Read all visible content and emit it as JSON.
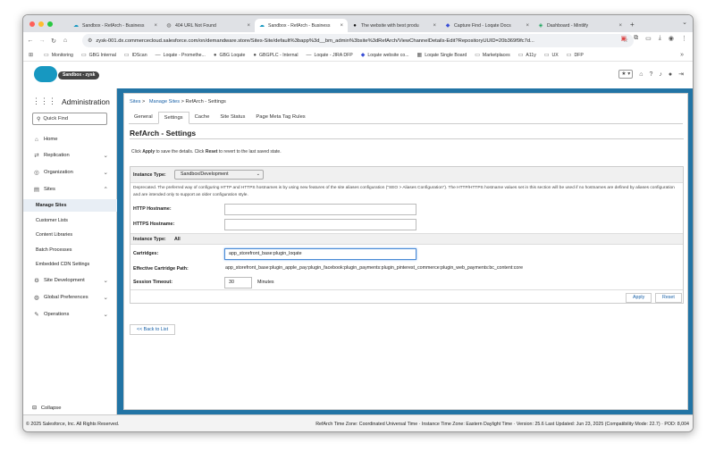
{
  "browser": {
    "tabs": [
      {
        "title": "Sandbox - RefArch - Business",
        "active": false,
        "icon": "salesforce-icon"
      },
      {
        "title": "404 URL Not Found",
        "active": false,
        "icon": "globe-icon"
      },
      {
        "title": "Sandbox - RefArch - Business",
        "active": true,
        "icon": "salesforce-icon"
      },
      {
        "title": "The website with best produ",
        "active": false,
        "icon": "dark-icon"
      },
      {
        "title": "Capture Find - Loqate Docs",
        "active": false,
        "icon": "loqate-icon"
      },
      {
        "title": "Dashboard - Mintlify",
        "active": false,
        "icon": "mintlify-icon"
      }
    ],
    "url": "zysk-001.dx.commercecloud.salesforce.com/on/demandware.store/Sites-Site/default%3bapp%3d__bm_admin%3bsite%3dRefArch/ViewChannelDetails-Edit?RepositoryUUID=20b369f9fc7d...",
    "bookmarks": [
      {
        "label": "Monitoring",
        "icon": "folder-icon"
      },
      {
        "label": "GBG Internal",
        "icon": "folder-icon"
      },
      {
        "label": "IDScan",
        "icon": "folder-icon"
      },
      {
        "label": "Loqate - Promethe...",
        "icon": "dash-icon"
      },
      {
        "label": "GBG Loqate",
        "icon": "github-icon"
      },
      {
        "label": "GBGPLC - Internal",
        "icon": "github-icon"
      },
      {
        "label": "Loqate - JIRA DFP",
        "icon": "dash-icon"
      },
      {
        "label": "Loqate website co...",
        "icon": "loqate-icon"
      },
      {
        "label": "Loqate Single Board",
        "icon": "board-icon"
      },
      {
        "label": "Marketplaces",
        "icon": "folder-icon"
      },
      {
        "label": "A11y",
        "icon": "folder-icon"
      },
      {
        "label": "UX",
        "icon": "folder-icon"
      },
      {
        "label": "DFP",
        "icon": "folder-icon"
      }
    ]
  },
  "header": {
    "org_label": "Sandbox - zysk"
  },
  "sidebar": {
    "title": "Administration",
    "quick_find_placeholder": "Quick Find",
    "items": [
      {
        "label": "Home",
        "icon": "home-icon",
        "chevron": ""
      },
      {
        "label": "Replication",
        "icon": "replication-icon",
        "chevron": "⌄"
      },
      {
        "label": "Organization",
        "icon": "organization-icon",
        "chevron": "⌄"
      },
      {
        "label": "Sites",
        "icon": "sites-icon",
        "chevron": "⌃"
      }
    ],
    "sub_items": [
      "Manage Sites",
      "Customer Lists",
      "Content Libraries",
      "Batch Processes",
      "Embedded CDN Settings"
    ],
    "items_after": [
      {
        "label": "Site Development",
        "icon": "site-development-icon",
        "chevron": "⌄"
      },
      {
        "label": "Global Preferences",
        "icon": "globe-icon",
        "chevron": "⌄"
      },
      {
        "label": "Operations",
        "icon": "wrench-icon",
        "chevron": "⌄"
      }
    ],
    "collapse_label": "Collapse"
  },
  "main": {
    "breadcrumb": {
      "sites": "Sites",
      "sep": ">",
      "manage": "Manage Sites",
      "current": "RefArch - Settings"
    },
    "tabs": [
      "General",
      "Settings",
      "Cache",
      "Site Status",
      "Page Meta Tag Rules"
    ],
    "title": "RefArch - Settings",
    "hint_pre": "Click ",
    "hint_apply": "Apply",
    "hint_mid": " to save the details. Click ",
    "hint_reset": "Reset",
    "hint_post": " to revert to the last saved state.",
    "form": {
      "instance_type_label": "Instance Type:",
      "instance_type_value": "Sandbox/Development",
      "deprecated_text": "Deprecated. The preferred way of configuring HTTP and HTTPS hostnames is by using new features of the site aliases configuration (\"SEO > Aliases Configuration\"). The HTTP/HTTPS hostname values set in this section will be used if no hostnames are defined by aliases configuration and are intended only to support an older configuration style.",
      "http_label": "HTTP Hostname:",
      "http_value": "",
      "https_label": "HTTPS Hostname:",
      "https_value": "",
      "instance_all_label": "Instance Type:",
      "instance_all_value": "All",
      "cartridges_label": "Cartridges:",
      "cartridges_value": "app_storefront_base:plugin_loqate",
      "effective_label": "Effective Cartridge Path:",
      "effective_value": "app_storefront_base:plugin_apple_pay:plugin_facebook:plugin_payments:plugin_pinterest_commerce:plugin_web_payments:bc_content:core",
      "session_label": "Session Timeout:",
      "session_value": "30",
      "session_unit": "Minutes"
    },
    "apply_label": "Apply",
    "reset_label": "Reset",
    "back_label": "<< Back to List"
  },
  "footer": {
    "copyright": "© 2025 Salesforce, Inc. All Rights Reserved.",
    "info": "RefArch Time Zone: Coordinated Universal Time  ·  Instance Time Zone: Eastern Daylight Time  ·  Version: 25.6 Last Updated: Jun 23, 2025 (Compatibility Mode: 22.7)  ·  POD: 8,004"
  },
  "colors": {
    "accent": "#1a62a8",
    "page_bg": "#2274a5",
    "sf_cloud": "#1798c1"
  }
}
